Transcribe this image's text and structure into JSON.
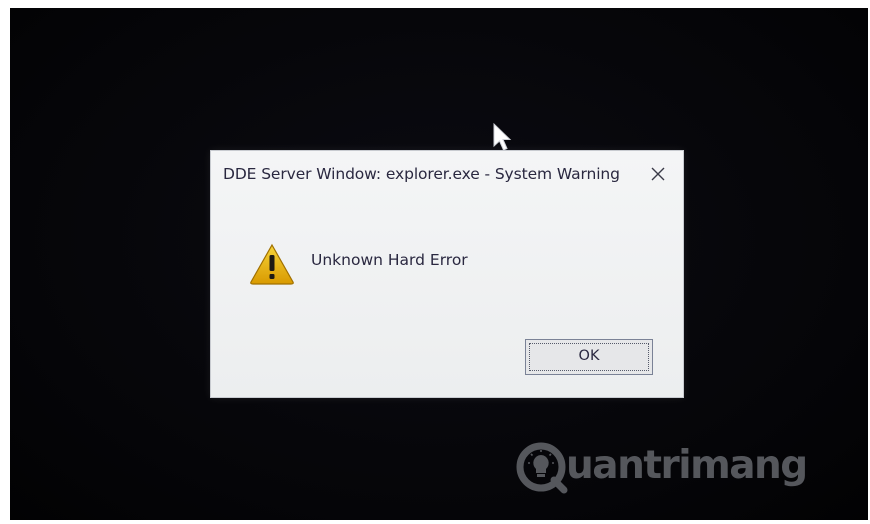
{
  "dialog": {
    "title": "DDE Server Window: explorer.exe - System Warning",
    "close_symbol": "✕",
    "message": "Unknown Hard Error",
    "icon": "warning-icon",
    "ok_label": "OK"
  },
  "watermark": {
    "text": "uantrimang",
    "logo": "lightbulb-q-logo"
  },
  "colors": {
    "background": "#050508",
    "dialog_bg": "#eceeef",
    "text": "#2a2840",
    "warning_yellow": "#e8b400",
    "watermark": "#55575c"
  }
}
